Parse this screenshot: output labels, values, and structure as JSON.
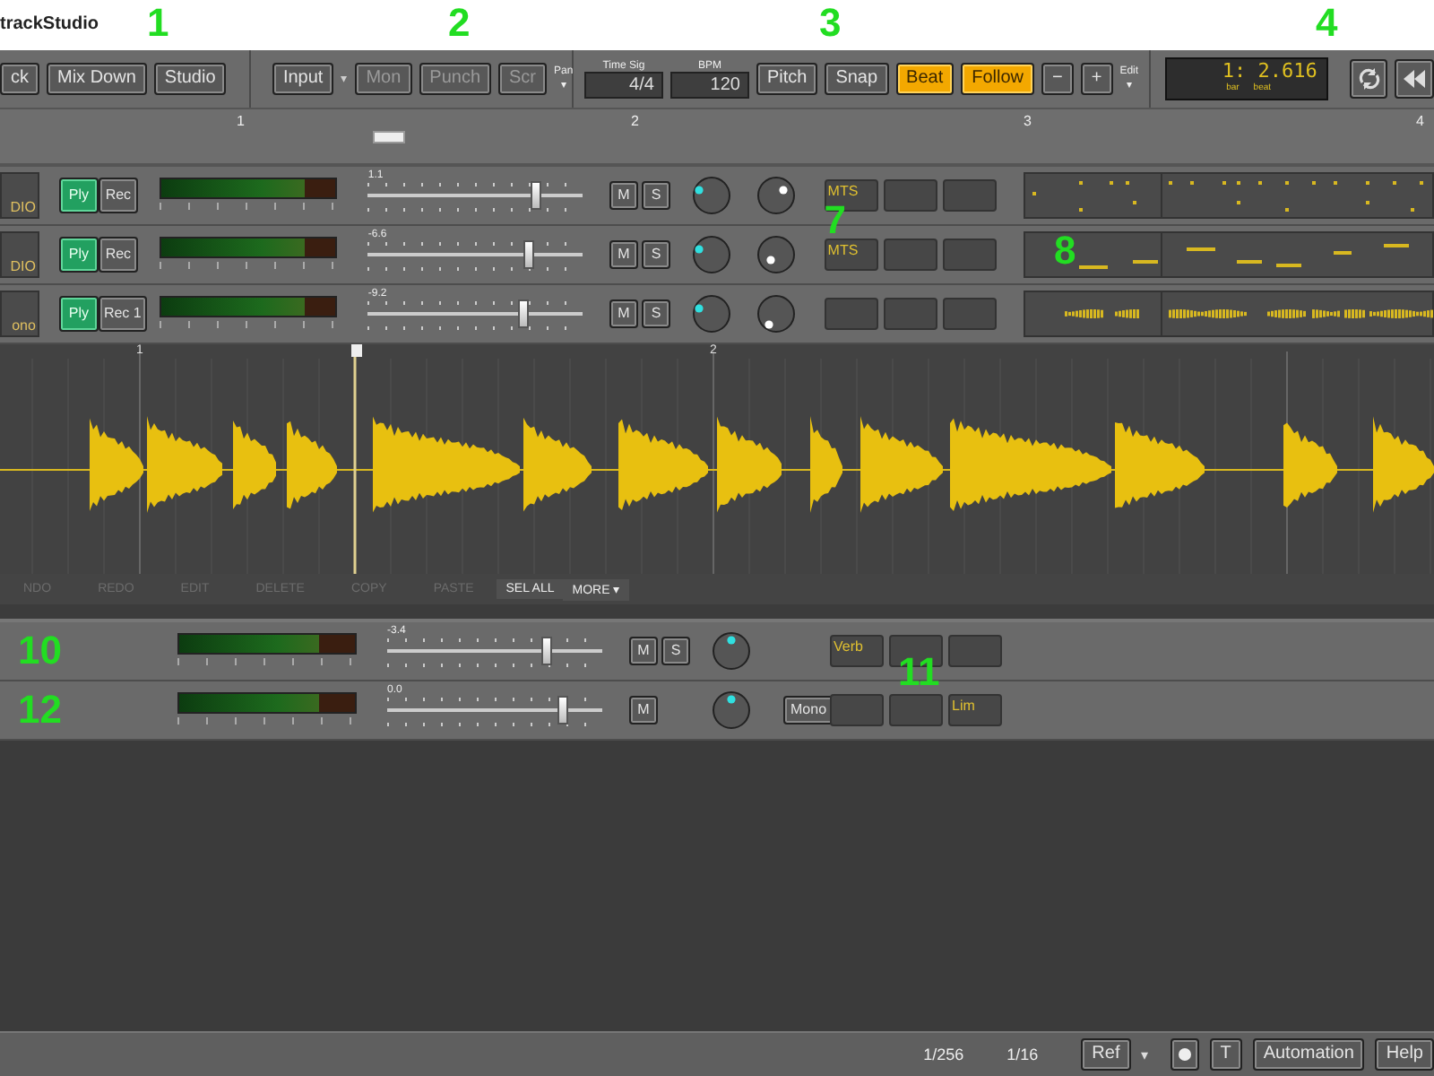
{
  "app": {
    "title": "trackStudio"
  },
  "toolbar": {
    "groups": [
      {
        "callout": "1",
        "items": [
          {
            "kind": "button",
            "label": "ck",
            "on": false
          },
          {
            "kind": "button",
            "label": "Mix Down",
            "on": false
          },
          {
            "kind": "button",
            "label": "Studio",
            "on": false
          }
        ]
      },
      {
        "callout": "2",
        "items": [
          {
            "kind": "dropdown",
            "label": "Input",
            "caret": "▾"
          },
          {
            "kind": "button",
            "label": "Mon",
            "on": false
          },
          {
            "kind": "button",
            "label": "Punch",
            "on": false
          },
          {
            "kind": "button",
            "label": "Scr",
            "on": false
          },
          {
            "kind": "menu",
            "label": "Pan",
            "caret": "▾"
          }
        ]
      },
      {
        "callout": "3",
        "items": [
          {
            "kind": "field",
            "label": "Time Sig",
            "value": "4/4"
          },
          {
            "kind": "field",
            "label": "BPM",
            "value": "120"
          },
          {
            "kind": "button",
            "label": "Pitch",
            "on": false
          },
          {
            "kind": "button",
            "label": "Snap",
            "on": false
          },
          {
            "kind": "button",
            "label": "Beat",
            "on": true
          },
          {
            "kind": "button",
            "label": "Follow",
            "on": true
          },
          {
            "kind": "button",
            "label": "−",
            "on": false
          },
          {
            "kind": "button",
            "label": "+",
            "on": false
          },
          {
            "kind": "menu",
            "label": "Edit",
            "caret": "▾"
          }
        ]
      }
    ],
    "counter": {
      "callout": "4",
      "position": "1: 2.616",
      "bar_label": "bar",
      "beat_label": "beat"
    }
  },
  "ruler": {
    "marks": [
      "1",
      "2",
      "3",
      "4"
    ]
  },
  "tracks": [
    {
      "name": "DIO",
      "play_label": "Ply",
      "play_on": true,
      "rec_label": "Rec",
      "rec_on": false,
      "meter": {
        "level": 0.82
      },
      "reading": "1.1",
      "level": 0.78,
      "mute_label": "M",
      "solo": true,
      "solo_label": "S",
      "slots": [
        {
          "kind": "effect",
          "label": "MTS",
          "callout": "7"
        },
        {
          "kind": "empty"
        },
        {
          "kind": "empty"
        }
      ],
      "lane": {
        "kind": "midi-dots"
      }
    },
    {
      "name": "DIO",
      "play_label": "Ply",
      "play_on": true,
      "rec_label": "Rec",
      "rec_on": false,
      "meter": {
        "level": 0.82
      },
      "reading": "-6.6",
      "level": 0.75,
      "mute_label": "M",
      "solo": true,
      "solo_label": "S",
      "slots": [
        {
          "kind": "effect",
          "label": "MTS"
        },
        {
          "kind": "empty"
        },
        {
          "kind": "empty"
        }
      ],
      "lane": {
        "kind": "midi-notes",
        "callout": "8"
      }
    },
    {
      "name": "ono",
      "play_label": "Ply",
      "play_on": true,
      "rec_label": "Rec 1",
      "rec_on": false,
      "meter": {
        "level": 0.82
      },
      "reading": "-9.2",
      "level": 0.72,
      "mute_label": "M",
      "solo": true,
      "solo_label": "S",
      "slots": [
        {
          "kind": "empty"
        },
        {
          "kind": "empty"
        },
        {
          "kind": "empty"
        }
      ],
      "lane": {
        "kind": "audio"
      }
    }
  ],
  "editor": {
    "marks": [
      "1",
      "2"
    ],
    "buttons": [
      {
        "label": "NDO",
        "disabled": true
      },
      {
        "label": "REDO",
        "disabled": true
      },
      {
        "label": "EDIT",
        "disabled": true
      },
      {
        "label": "DELETE",
        "disabled": true
      },
      {
        "label": "COPY",
        "disabled": true
      },
      {
        "label": "PASTE",
        "disabled": true
      },
      {
        "label": "SEL ALL",
        "disabled": false
      },
      {
        "label": "MORE ▾",
        "disabled": false
      }
    ]
  },
  "buses": [
    {
      "callout": "10",
      "meter": {
        "level": 0.8
      },
      "reading": "-3.4",
      "level": 0.74,
      "mute_label": "M",
      "solo": true,
      "solo_label": "S",
      "mono": false,
      "slots": [
        {
          "kind": "effect",
          "label": "Verb"
        },
        {
          "kind": "empty",
          "callout": "11"
        },
        {
          "kind": "empty"
        }
      ]
    },
    {
      "callout": "12",
      "meter": {
        "level": 0.8
      },
      "reading": "0.0",
      "level": 0.82,
      "mute_label": "M",
      "solo": false,
      "mono": true,
      "mono_label": "Mono",
      "slots": [
        {
          "kind": "empty"
        },
        {
          "kind": "empty"
        },
        {
          "kind": "effect",
          "label": "Lim"
        }
      ]
    }
  ],
  "status_bar": {
    "values": [
      "1/256",
      "1/16"
    ],
    "buttons": [
      {
        "kind": "dropdown",
        "label": "Ref",
        "caret": "▾"
      },
      {
        "kind": "record"
      },
      {
        "kind": "button",
        "label": "T"
      },
      {
        "kind": "button",
        "label": "Automation"
      },
      {
        "kind": "button",
        "label": "Help"
      }
    ]
  }
}
